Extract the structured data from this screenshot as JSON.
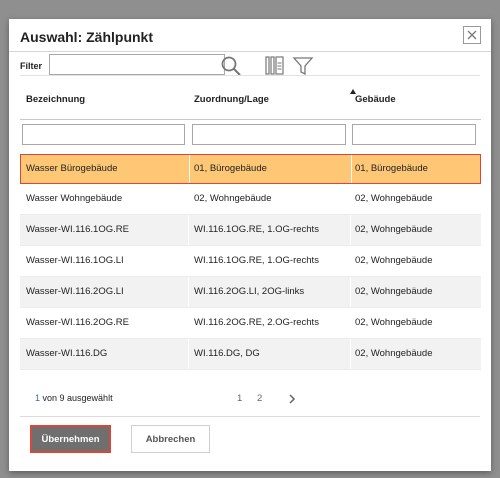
{
  "dialog": {
    "title": "Auswahl: Zählpunkt",
    "filter_label": "Filter",
    "filter_value": ""
  },
  "table": {
    "columns": [
      "Bezeichnung",
      "Zuordnung/Lage",
      "Gebäude"
    ],
    "sorted_column": "Zuordnung/Lage",
    "rows": [
      {
        "bezeichnung": "Wasser Bürogebäude",
        "zuordnung": "01, Bürogebäude",
        "gebaeude": "01, Bürogebäude",
        "selected": true
      },
      {
        "bezeichnung": "Wasser Wohngebäude",
        "zuordnung": "02, Wohngebäude",
        "gebaeude": "02, Wohngebäude",
        "selected": false
      },
      {
        "bezeichnung": "Wasser-WI.116.1OG.RE",
        "zuordnung": "WI.116.1OG.RE, 1.OG-rechts",
        "gebaeude": "02, Wohngebäude",
        "selected": false
      },
      {
        "bezeichnung": "Wasser-WI.116.1OG.LI",
        "zuordnung": "WI.116.1OG.RE, 1.OG-rechts",
        "gebaeude": "02, Wohngebäude",
        "selected": false
      },
      {
        "bezeichnung": "Wasser-WI.116.2OG.LI",
        "zuordnung": "WI.116.2OG.LI, 2OG-links",
        "gebaeude": "02, Wohngebäude",
        "selected": false
      },
      {
        "bezeichnung": "Wasser-WI.116.2OG.RE",
        "zuordnung": "WI.116.2OG.RE, 2.OG-rechts",
        "gebaeude": "02, Wohngebäude",
        "selected": false
      },
      {
        "bezeichnung": "Wasser-WI.116.DG",
        "zuordnung": "WI.116.DG, DG",
        "gebaeude": "02, Wohngebäude",
        "selected": false
      }
    ]
  },
  "status": {
    "count": "1",
    "text": " von 9 ausgewählt"
  },
  "pager": {
    "pages": [
      "1",
      "2"
    ],
    "next": "›"
  },
  "buttons": {
    "apply": "Übernehmen",
    "cancel": "Abbrechen"
  },
  "icons": {
    "close": "close-icon",
    "search": "search-icon",
    "columns": "columns-icon",
    "filter": "funnel-icon"
  },
  "colors": {
    "selected_row": "#fdc776",
    "selected_border": "#d9473a",
    "primary_button": "#6f6f6f"
  }
}
